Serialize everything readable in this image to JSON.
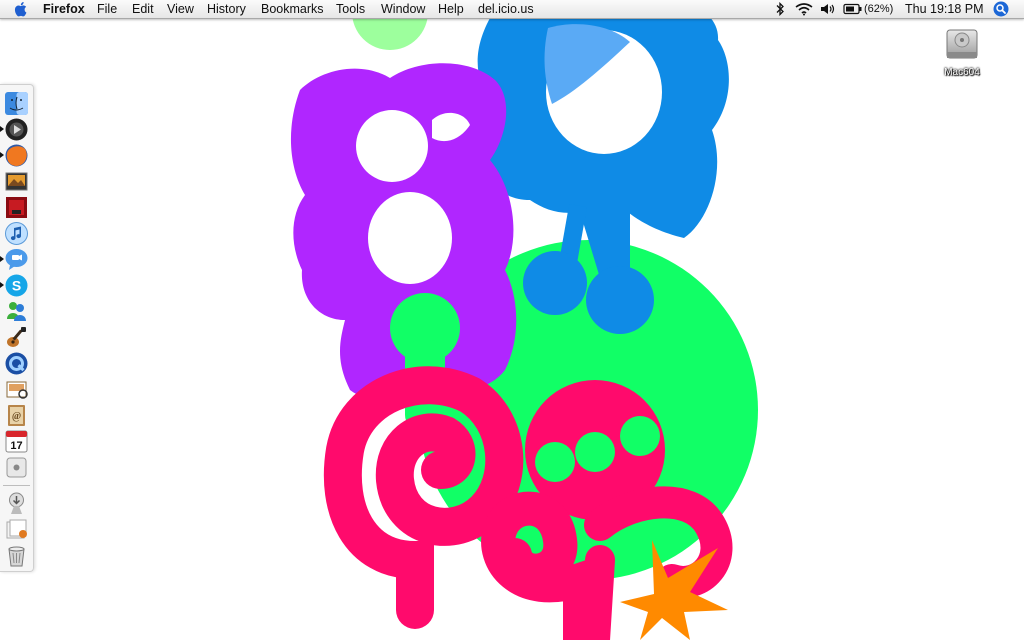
{
  "menubar": {
    "app_name": "Firefox",
    "menus": [
      "File",
      "Edit",
      "View",
      "History",
      "Bookmarks",
      "Tools",
      "Window",
      "Help",
      "del.icio.us"
    ],
    "battery_percent": "(62%)",
    "clock": "Thu 19:18 PM"
  },
  "desktop": {
    "drive_label": "Mac604"
  },
  "dock": {
    "items": [
      {
        "name": "finder-icon"
      },
      {
        "name": "front-row-icon"
      },
      {
        "name": "firefox-icon"
      },
      {
        "name": "iphoto-icon"
      },
      {
        "name": "photo-booth-icon"
      },
      {
        "name": "itunes-icon"
      },
      {
        "name": "ichat-icon"
      },
      {
        "name": "skype-icon"
      },
      {
        "name": "msn-messenger-icon"
      },
      {
        "name": "garageband-icon"
      },
      {
        "name": "quicktime-icon"
      },
      {
        "name": "preview-icon"
      },
      {
        "name": "address-book-icon"
      },
      {
        "name": "ical-icon",
        "text": "17"
      },
      {
        "name": "system-icon"
      },
      {
        "name": "downloads-stack-icon"
      },
      {
        "name": "documents-stack-icon"
      },
      {
        "name": "trash-icon"
      }
    ]
  },
  "colors": {
    "purple": "#b026ff",
    "blue": "#0f8be6",
    "light_blue": "#5aaaf5",
    "green": "#11ff66",
    "light_green": "#9dff9d",
    "pink": "#ff0a6c",
    "orange": "#ff8a00"
  }
}
